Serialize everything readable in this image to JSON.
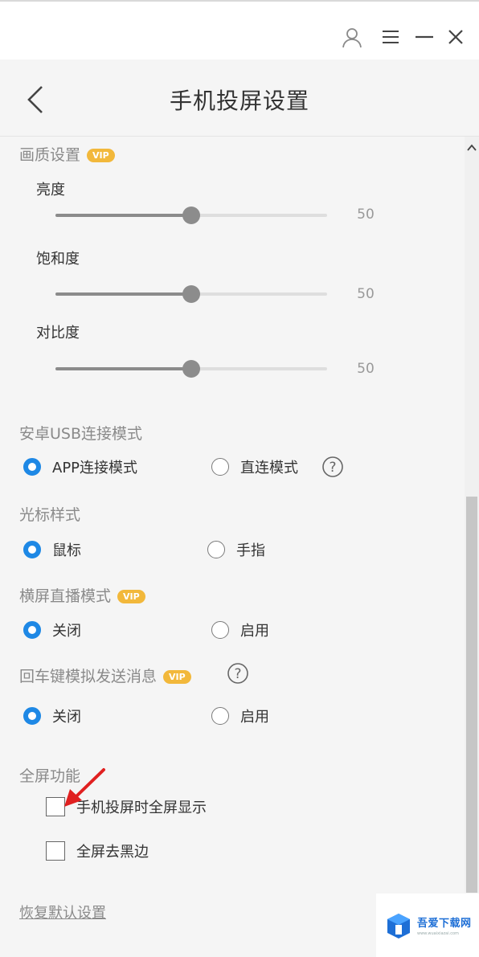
{
  "window": {
    "icons": {
      "user": "user-icon",
      "menu": "menu-icon",
      "minimize": "minimize-icon",
      "close": "close-icon"
    }
  },
  "header": {
    "title": "手机投屏设置",
    "back_icon": "back-icon"
  },
  "picture_quality": {
    "title": "画质设置",
    "vip_badge": "VIP",
    "sliders": [
      {
        "label": "亮度",
        "value": 50,
        "fraction": 0.5
      },
      {
        "label": "饱和度",
        "value": 50,
        "fraction": 0.5
      },
      {
        "label": "对比度",
        "value": 50,
        "fraction": 0.5
      }
    ]
  },
  "usb_mode": {
    "title": "安卓USB连接模式",
    "options": [
      "APP连接模式",
      "直连模式"
    ],
    "selected": "APP连接模式",
    "help_icon": "help-icon"
  },
  "cursor_style": {
    "title": "光标样式",
    "options": [
      "鼠标",
      "手指"
    ],
    "selected": "鼠标"
  },
  "landscape_live": {
    "title": "横屏直播模式",
    "vip_badge": "VIP",
    "options": [
      "关闭",
      "启用"
    ],
    "selected": "关闭"
  },
  "enter_key": {
    "title": "回车键模拟发送消息",
    "vip_badge": "VIP",
    "options": [
      "关闭",
      "启用"
    ],
    "selected": "关闭",
    "help_icon": "help-icon"
  },
  "fullscreen": {
    "title": "全屏功能",
    "checkboxes": [
      {
        "label": "手机投屏时全屏显示",
        "checked": false
      },
      {
        "label": "全屏去黑边",
        "checked": false
      }
    ]
  },
  "reset_label": "恢复默认设置",
  "watermark": {
    "name": "吾爱下载网",
    "url": "www.wuaixiazai.com"
  },
  "colors": {
    "accent": "#1e88e5",
    "vip": "#f2b83b",
    "arrow": "#e02020"
  }
}
